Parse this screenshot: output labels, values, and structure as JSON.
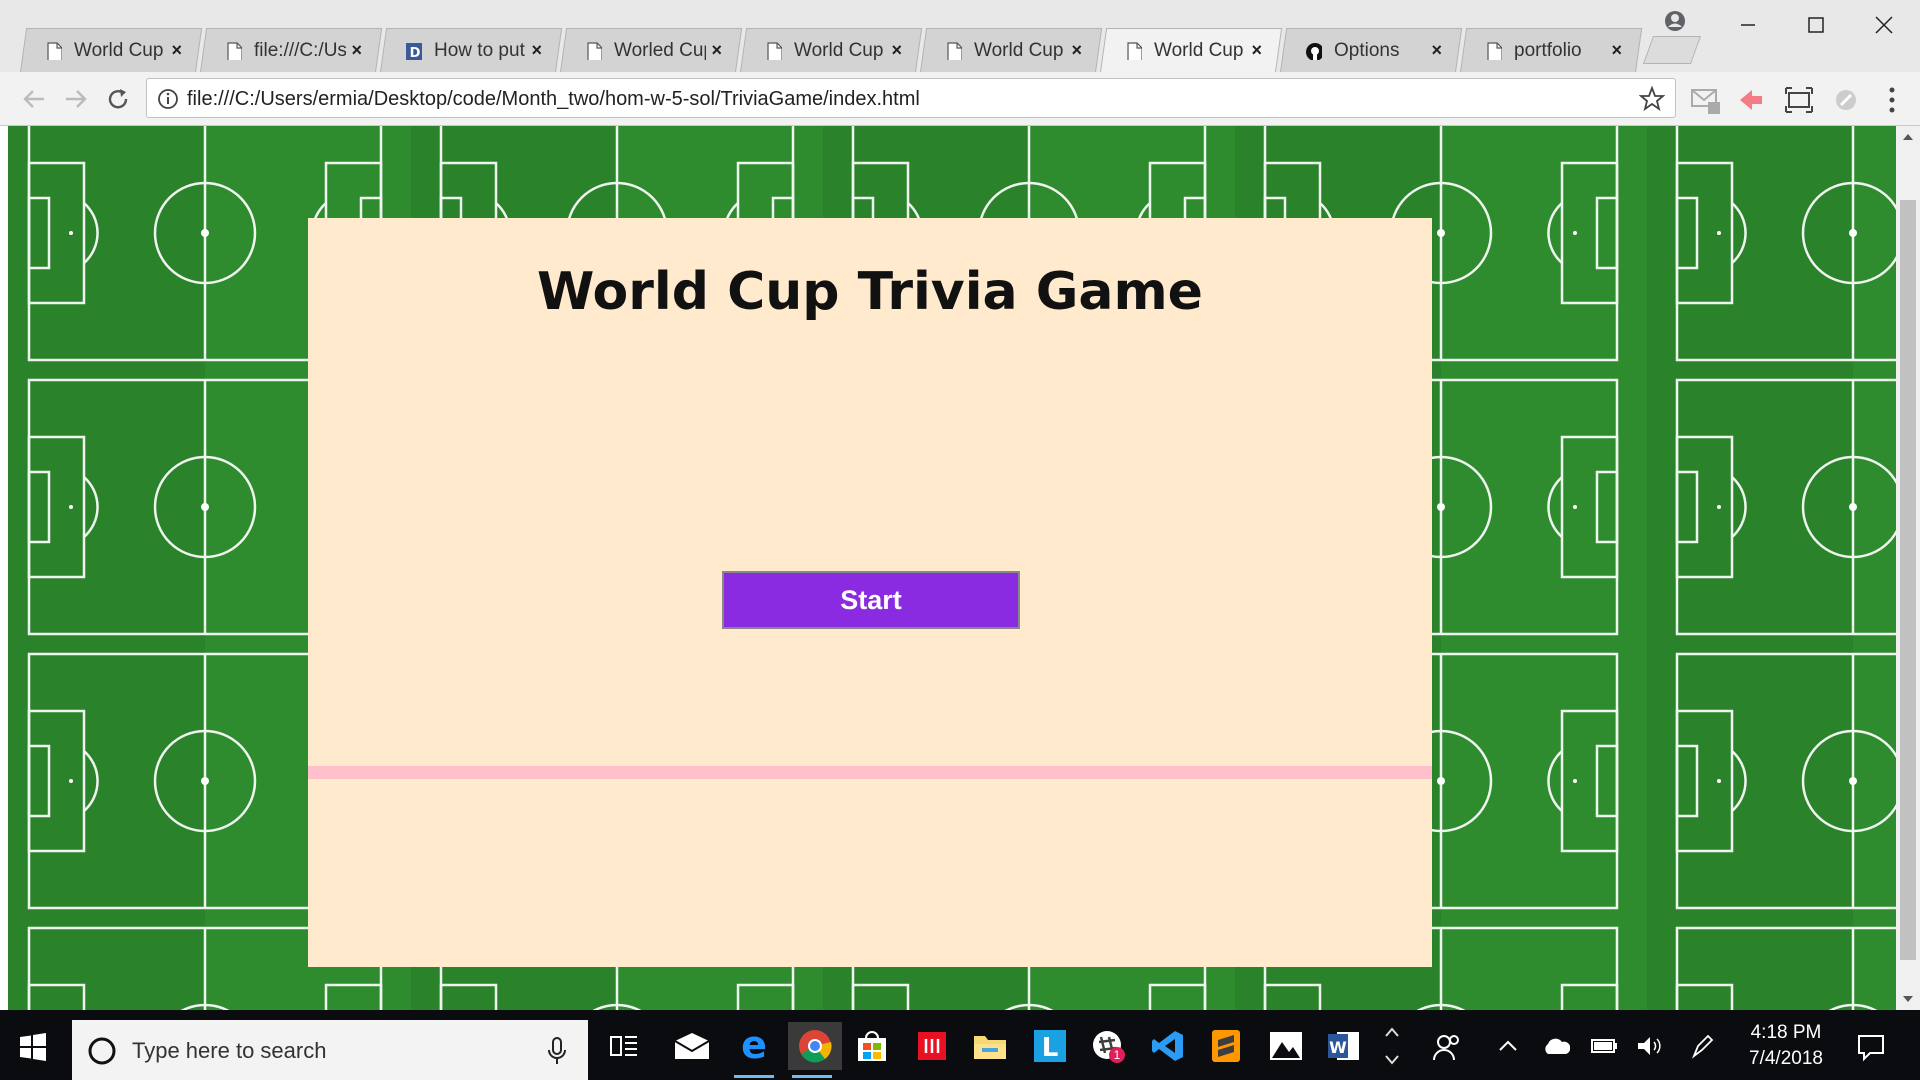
{
  "browser": {
    "tabs": [
      {
        "title": "World Cup",
        "icon": "page-icon",
        "active": false
      },
      {
        "title": "file:///C:/Us",
        "icon": "page-icon",
        "active": false
      },
      {
        "title": "How to put",
        "icon": "d-favicon",
        "active": false
      },
      {
        "title": "Worled Cup",
        "icon": "page-icon",
        "active": false
      },
      {
        "title": "World Cup",
        "icon": "page-icon",
        "active": false
      },
      {
        "title": "World Cup",
        "icon": "page-icon",
        "active": false
      },
      {
        "title": "World Cup",
        "icon": "page-icon",
        "active": true
      },
      {
        "title": "Options",
        "icon": "github-icon",
        "active": false
      },
      {
        "title": "portfolio",
        "icon": "page-icon",
        "active": false
      }
    ],
    "url": "file:///C:/Users/ermia/Desktop/code/Month_two/hom-w-5-sol/TriviaGame/index.html"
  },
  "page": {
    "title": "World Cup Trivia Game",
    "start_label": "Start"
  },
  "taskbar": {
    "search_placeholder": "Type here to search",
    "time": "4:18 PM",
    "date": "7/4/2018",
    "notification_count": "1"
  },
  "colors": {
    "panel_bg": "#ffeacd",
    "start_button": "#8a2be2",
    "divider": "#ffc0cb",
    "grass": "#2e8b2e"
  }
}
